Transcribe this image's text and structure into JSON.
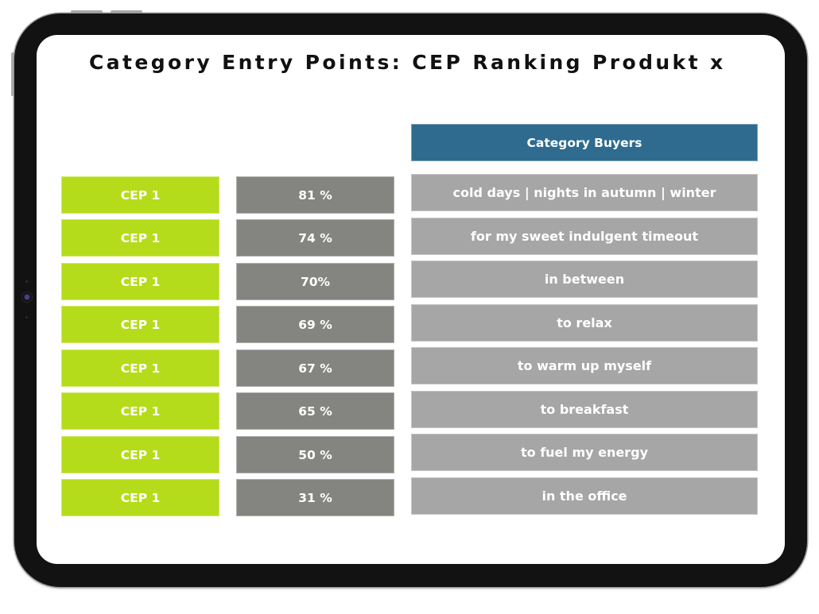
{
  "title": "Category Entry Points: CEP Ranking Produkt x",
  "header": {
    "category_buyers": "Category Buyers"
  },
  "colors": {
    "cep_green": "#b5dc1a",
    "percent_gray": "#848480",
    "situation_gray": "#a6a6a6",
    "header_blue": "#2e6b8f",
    "device_frame": "#121212"
  },
  "rows": [
    {
      "cep": "CEP 1",
      "percent": "81 %",
      "situation": "cold days | nights in autumn | winter"
    },
    {
      "cep": "CEP 1",
      "percent": "74 %",
      "situation": "for my sweet indulgent timeout"
    },
    {
      "cep": "CEP 1",
      "percent": "70%",
      "situation": "in between"
    },
    {
      "cep": "CEP 1",
      "percent": "69 %",
      "situation": "to relax"
    },
    {
      "cep": "CEP 1",
      "percent": "67 %",
      "situation": "to warm up myself"
    },
    {
      "cep": "CEP 1",
      "percent": "65 %",
      "situation": "to breakfast"
    },
    {
      "cep": "CEP 1",
      "percent": "50 %",
      "situation": "to fuel my energy"
    },
    {
      "cep": "CEP 1",
      "percent": "31 %",
      "situation": "in the office"
    }
  ]
}
